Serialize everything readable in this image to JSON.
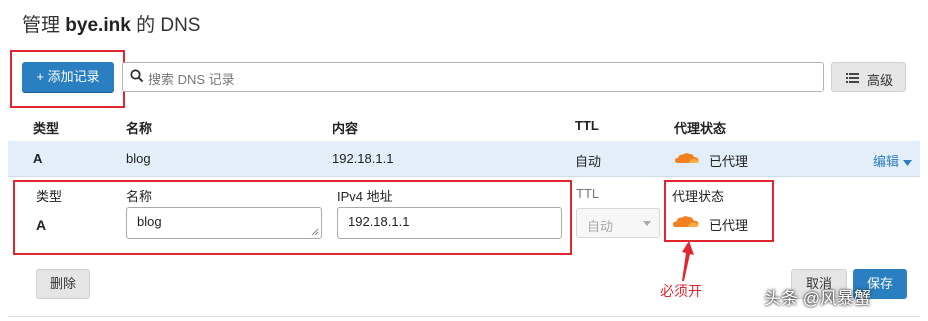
{
  "header": {
    "prefix": "管理",
    "domain": "bye.ink",
    "middle": "的",
    "suffix": "DNS"
  },
  "toolbar": {
    "add_label": "+ 添加记录",
    "search_placeholder": "搜索 DNS 记录",
    "advanced_label": "高级"
  },
  "table": {
    "columns": [
      "类型",
      "名称",
      "内容",
      "TTL",
      "代理状态"
    ],
    "row": {
      "type": "A",
      "name": "blog",
      "content": "192.18.1.1",
      "ttl": "自动",
      "proxy": "已代理",
      "edit": "编辑"
    }
  },
  "editor": {
    "type_label": "类型",
    "type_value": "A",
    "name_label": "名称",
    "name_value": "blog",
    "ip_label": "IPv4 地址",
    "ip_value": "192.18.1.1",
    "ttl_label": "TTL",
    "ttl_value": "自动",
    "proxy_label": "代理状态",
    "proxy_value": "已代理",
    "delete_label": "删除",
    "cancel_label": "取消",
    "save_label": "保存"
  },
  "annotation": {
    "note": "必须开"
  },
  "watermark": "头条 @风暴蟹",
  "colors": {
    "accent": "#2a7fc1",
    "cloud": "#f38020",
    "highlight": "#e0262f",
    "row_bg": "#e3eef8"
  },
  "icons": [
    "search-icon",
    "list-icon",
    "cloud-icon",
    "caret-down-icon",
    "resize-grip-icon"
  ]
}
